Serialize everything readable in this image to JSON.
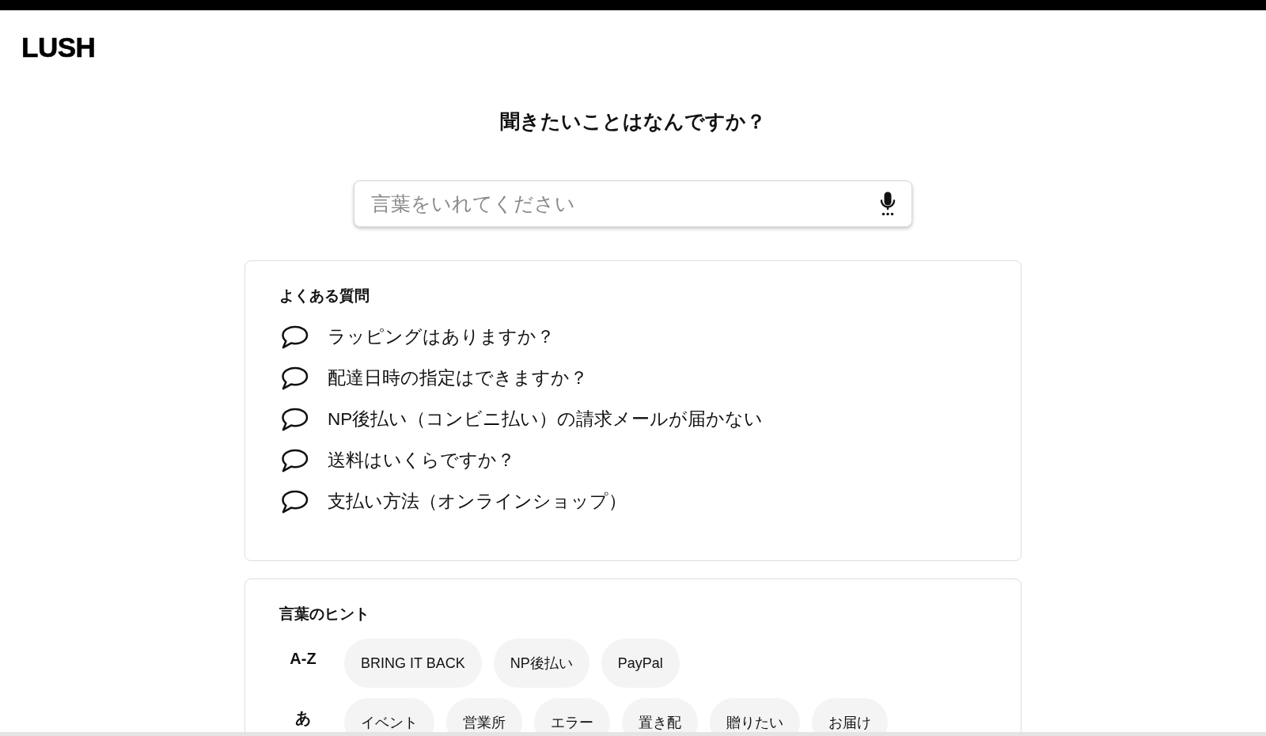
{
  "logo": "LUSH",
  "heading": "聞きたいことはなんですか？",
  "search": {
    "placeholder": "言葉をいれてください"
  },
  "faq": {
    "title": "よくある質問",
    "items": [
      "ラッピングはありますか？",
      "配達日時の指定はできますか？",
      "NP後払い（コンビニ払い）の請求メールが届かない",
      "送料はいくらですか？",
      "支払い方法（オンラインショップ）"
    ]
  },
  "hints": {
    "title": "言葉のヒント",
    "groups": [
      {
        "label": "A-Z",
        "words": [
          "BRING IT BACK",
          "NP後払い",
          "PayPal"
        ]
      },
      {
        "label": "あ",
        "words": [
          "イベント",
          "営業所",
          "エラー",
          "置き配",
          "贈りたい",
          "お届け"
        ]
      }
    ]
  }
}
